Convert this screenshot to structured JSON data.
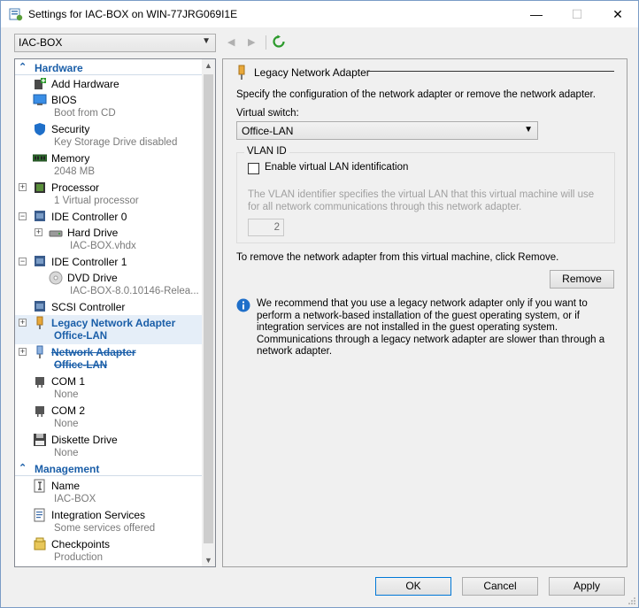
{
  "window": {
    "title": "Settings for IAC-BOX on WIN-77JRG069I1E",
    "controls": {
      "minimize": "—",
      "maximize": "☐",
      "close": "✕"
    }
  },
  "toolbar": {
    "vm_selector": "IAC-BOX",
    "back_glyph": "◀",
    "forward_glyph": "▶",
    "refresh_icon": "refresh-icon"
  },
  "tree": {
    "hardware_section": "Hardware",
    "management_section": "Management",
    "items": [
      {
        "name": "Add Hardware",
        "sub": ""
      },
      {
        "name": "BIOS",
        "sub": "Boot from CD"
      },
      {
        "name": "Security",
        "sub": "Key Storage Drive disabled"
      },
      {
        "name": "Memory",
        "sub": "2048 MB"
      },
      {
        "name": "Processor",
        "sub": "1 Virtual processor"
      },
      {
        "name": "IDE Controller 0",
        "sub": ""
      },
      {
        "name": "Hard Drive",
        "sub": "IAC-BOX.vhdx"
      },
      {
        "name": "IDE Controller 1",
        "sub": ""
      },
      {
        "name": "DVD Drive",
        "sub": "IAC-BOX-8.0.10146-Relea..."
      },
      {
        "name": "SCSI Controller",
        "sub": ""
      },
      {
        "name": "Legacy Network Adapter",
        "sub": "Office-LAN"
      },
      {
        "name": "Network Adapter",
        "sub": "Office-LAN"
      },
      {
        "name": "COM 1",
        "sub": "None"
      },
      {
        "name": "COM 2",
        "sub": "None"
      },
      {
        "name": "Diskette Drive",
        "sub": "None"
      },
      {
        "name": "Name",
        "sub": "IAC-BOX"
      },
      {
        "name": "Integration Services",
        "sub": "Some services offered"
      },
      {
        "name": "Checkpoints",
        "sub": "Production"
      }
    ]
  },
  "panel": {
    "title": "Legacy Network Adapter",
    "description": "Specify the configuration of the network adapter or remove the network adapter.",
    "virtual_switch_label": "Virtual switch:",
    "virtual_switch_value": "Office-LAN",
    "vlan_group": "VLAN ID",
    "vlan_checkbox_label": "Enable virtual LAN identification",
    "vlan_help": "The VLAN identifier specifies the virtual LAN that this virtual machine will use for all network communications through this network adapter.",
    "vlan_value": "2",
    "remove_description": "To remove the network adapter from this virtual machine, click Remove.",
    "remove_button": "Remove",
    "info_text": "We recommend that you use a legacy network adapter only if you want to perform a network-based installation of the guest operating system, or if integration services are not installed in the guest operating system. Communications through a legacy network adapter are slower than through a network adapter."
  },
  "buttons": {
    "ok": "OK",
    "cancel": "Cancel",
    "apply": "Apply"
  },
  "colors": {
    "accent": "#1a5ea8",
    "selected_bg": "#e5eef8",
    "ok_border": "#0078d7"
  }
}
